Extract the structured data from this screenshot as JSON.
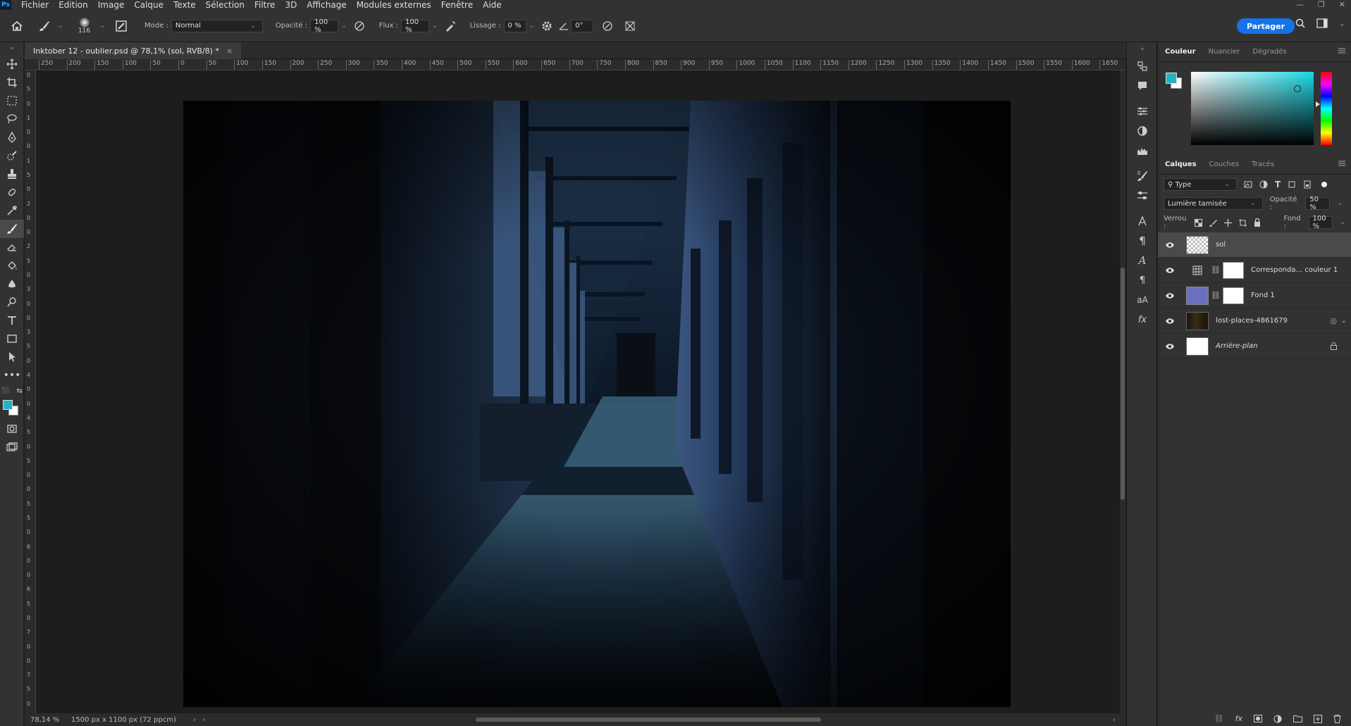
{
  "app": {
    "logo": "Ps",
    "menu": [
      "Fichier",
      "Edition",
      "Image",
      "Calque",
      "Texte",
      "Sélection",
      "Filtre",
      "3D",
      "Affichage",
      "Modules externes",
      "Fenêtre",
      "Aide"
    ]
  },
  "options": {
    "brush_size": "116",
    "mode_label": "Mode :",
    "mode_value": "Normal",
    "opacity_label": "Opacité :",
    "opacity_value": "100 %",
    "flux_label": "Flux :",
    "flux_value": "100 %",
    "smoothing_label": "Lissage :",
    "smoothing_value": "0 %",
    "angle_value": "0°",
    "share_label": "Partager"
  },
  "document": {
    "tab_title": "Inktober 12 - oublier.psd @ 78,1% (sol, RVB/8) *",
    "close_glyph": "×"
  },
  "ruler_top_labels": [
    "250",
    "200",
    "150",
    "100",
    "50",
    "0",
    "50",
    "100",
    "150",
    "200",
    "250",
    "300",
    "350",
    "400",
    "450",
    "500",
    "550",
    "600",
    "650",
    "700",
    "750",
    "800",
    "850",
    "900",
    "950",
    "1000",
    "1050",
    "1100",
    "1150",
    "1200",
    "1250",
    "1300",
    "1350",
    "1400",
    "1450",
    "1500",
    "1550",
    "1600",
    "1650"
  ],
  "ruler_left_labels": [
    "0",
    "5",
    "0",
    "1",
    "0",
    "0",
    "1",
    "5",
    "0",
    "2",
    "0",
    "0",
    "2",
    "5",
    "0",
    "3",
    "0",
    "0",
    "3",
    "5",
    "0",
    "4",
    "0",
    "0",
    "4",
    "5",
    "0",
    "5",
    "0",
    "0",
    "5",
    "5",
    "0",
    "6",
    "0",
    "0",
    "6",
    "5",
    "0",
    "7",
    "0",
    "0",
    "7",
    "5",
    "0"
  ],
  "status": {
    "zoom": "78,14 %",
    "dimensions": "1500 px x 1100 px (72 ppcm)",
    "arrow": "›",
    "left_arrow": "‹",
    "right_arrow": "›"
  },
  "color_panel": {
    "tabs": [
      "Couleur",
      "Nuancier",
      "Dégradés"
    ],
    "foreground": "#22b3c7",
    "background": "#ffffff"
  },
  "layers_panel": {
    "tabs": [
      "Calques",
      "Couches",
      "Tracés"
    ],
    "filter_value": "Type",
    "blend_mode": "Lumière tamisée",
    "opacity_label": "Opacité :",
    "opacity_value": "50 %",
    "lock_label": "Verrou :",
    "fill_label": "Fond :",
    "fill_value": "100 %",
    "layers": [
      {
        "name": "sol",
        "kind": "transparent",
        "selected": true,
        "italic": false
      },
      {
        "name": "Correspondа... couleur 1",
        "kind": "adjustment",
        "selected": false,
        "italic": false
      },
      {
        "name": "Fond 1",
        "kind": "fill",
        "color": "#6a6fc0",
        "selected": false,
        "italic": false
      },
      {
        "name": "lost-places-4861679",
        "kind": "smart",
        "selected": false,
        "italic": false
      },
      {
        "name": "Arrière-plan",
        "kind": "background",
        "selected": false,
        "italic": true
      }
    ]
  }
}
